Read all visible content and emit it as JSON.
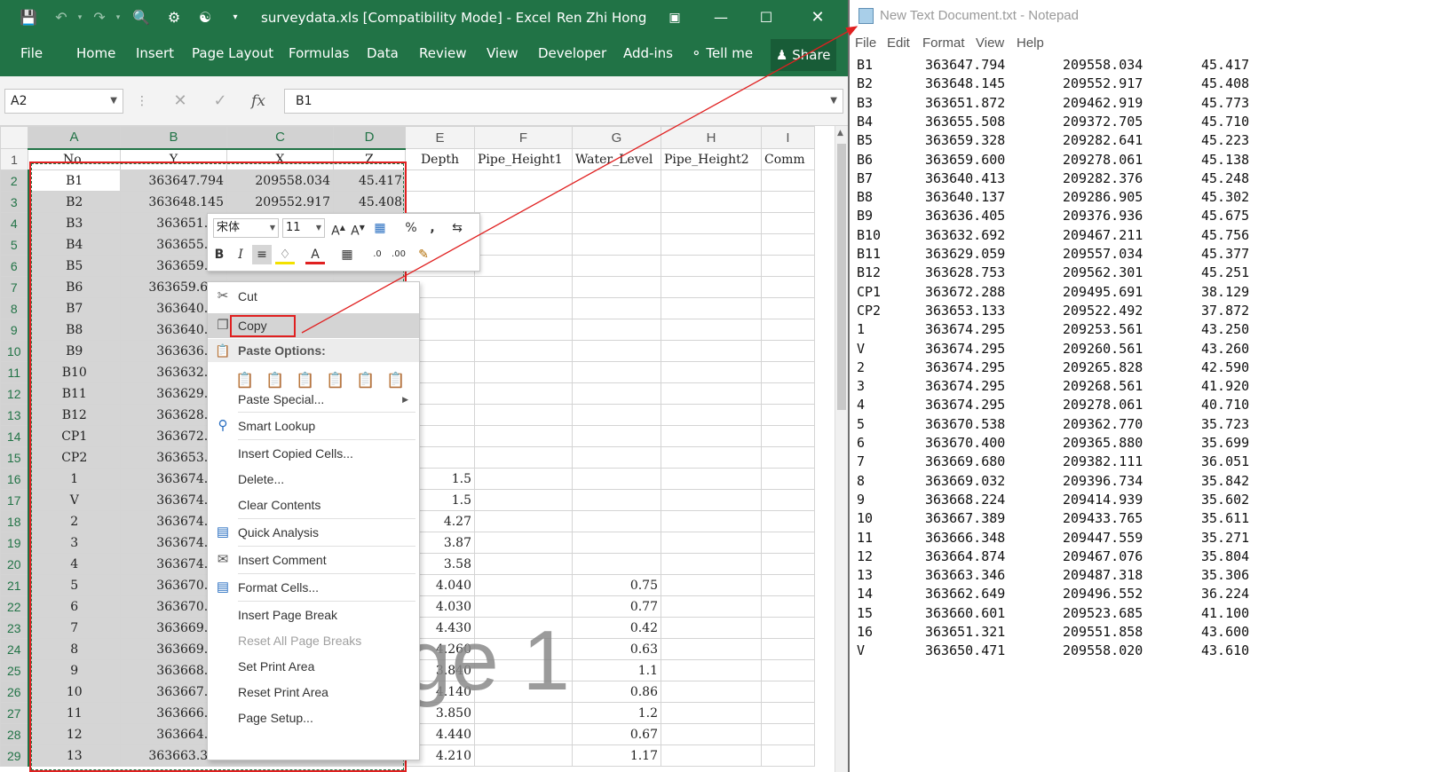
{
  "excel": {
    "title": "surveydata.xls  [Compatibility Mode]  -  Excel",
    "user": "Ren Zhi Hong",
    "ribbon_tabs": [
      "File",
      "Home",
      "Insert",
      "Page Layout",
      "Formulas",
      "Data",
      "Review",
      "View",
      "Developer",
      "Add-ins"
    ],
    "tell_me": "Tell me",
    "share": "Share",
    "name_box": "A2",
    "formula": "B1",
    "columns": [
      "A",
      "B",
      "C",
      "D",
      "E",
      "F",
      "G",
      "H",
      "I"
    ],
    "header_row": [
      "No.",
      "Y",
      "X",
      "Z",
      "Depth",
      "Pipe_Height1",
      "Water_Level",
      "Pipe_Height2",
      "Comm"
    ],
    "rows": [
      {
        "n": "2",
        "a": "B1",
        "b": "363647.794",
        "c": "209558.034",
        "d": "45.417",
        "e": "",
        "g": ""
      },
      {
        "n": "3",
        "a": "B2",
        "b": "363648.145",
        "c": "209552.917",
        "d": "45.408",
        "e": "",
        "g": ""
      },
      {
        "n": "4",
        "a": "B3",
        "b": "363651.87",
        "c": "",
        "d": "",
        "e": "",
        "g": ""
      },
      {
        "n": "5",
        "a": "B4",
        "b": "363655.50",
        "c": "",
        "d": "",
        "e": "",
        "g": ""
      },
      {
        "n": "6",
        "a": "B5",
        "b": "363659.32",
        "c": "",
        "d": "",
        "e": "",
        "g": ""
      },
      {
        "n": "7",
        "a": "B6",
        "b": "363659.600",
        "c": "209278.061",
        "d": "45.138",
        "e": "",
        "g": ""
      },
      {
        "n": "8",
        "a": "B7",
        "b": "363640.41",
        "c": "",
        "d": "",
        "e": "",
        "g": ""
      },
      {
        "n": "9",
        "a": "B8",
        "b": "363640.13",
        "c": "",
        "d": "",
        "e": "",
        "g": ""
      },
      {
        "n": "10",
        "a": "B9",
        "b": "363636.40",
        "c": "",
        "d": "",
        "e": "",
        "g": ""
      },
      {
        "n": "11",
        "a": "B10",
        "b": "363632.69",
        "c": "",
        "d": "",
        "e": "",
        "g": ""
      },
      {
        "n": "12",
        "a": "B11",
        "b": "363629.05",
        "c": "",
        "d": "",
        "e": "",
        "g": ""
      },
      {
        "n": "13",
        "a": "B12",
        "b": "363628.75",
        "c": "",
        "d": "",
        "e": "",
        "g": ""
      },
      {
        "n": "14",
        "a": "CP1",
        "b": "363672.28",
        "c": "",
        "d": "",
        "e": "",
        "g": ""
      },
      {
        "n": "15",
        "a": "CP2",
        "b": "363653.13",
        "c": "",
        "d": "",
        "e": "",
        "g": ""
      },
      {
        "n": "16",
        "a": "1",
        "b": "363674.29",
        "c": "",
        "d": "",
        "e": "1.5",
        "g": ""
      },
      {
        "n": "17",
        "a": "V",
        "b": "363674.29",
        "c": "",
        "d": "",
        "e": "1.5",
        "g": ""
      },
      {
        "n": "18",
        "a": "2",
        "b": "363674.29",
        "c": "",
        "d": "",
        "e": "4.27",
        "g": ""
      },
      {
        "n": "19",
        "a": "3",
        "b": "363674.29",
        "c": "",
        "d": "",
        "e": "3.87",
        "g": ""
      },
      {
        "n": "20",
        "a": "4",
        "b": "363674.29",
        "c": "",
        "d": "",
        "e": "3.58",
        "g": ""
      },
      {
        "n": "21",
        "a": "5",
        "b": "363670.53",
        "c": "",
        "d": "",
        "e": "4.040",
        "g": "0.75"
      },
      {
        "n": "22",
        "a": "6",
        "b": "363670.40",
        "c": "",
        "d": "",
        "e": "4.030",
        "g": "0.77"
      },
      {
        "n": "23",
        "a": "7",
        "b": "363669.68",
        "c": "",
        "d": "",
        "e": "4.430",
        "g": "0.42"
      },
      {
        "n": "24",
        "a": "8",
        "b": "363669.03",
        "c": "",
        "d": "",
        "e": "4.260",
        "g": "0.63"
      },
      {
        "n": "25",
        "a": "9",
        "b": "363668.22",
        "c": "",
        "d": "",
        "e": "3.840",
        "g": "1.1"
      },
      {
        "n": "26",
        "a": "10",
        "b": "363667.38",
        "c": "",
        "d": "",
        "e": "4.140",
        "g": "0.86"
      },
      {
        "n": "27",
        "a": "11",
        "b": "363666.34",
        "c": "",
        "d": "",
        "e": "3.850",
        "g": "1.2"
      },
      {
        "n": "28",
        "a": "12",
        "b": "363664.87",
        "c": "",
        "d": "",
        "e": "4.440",
        "g": "0.67"
      },
      {
        "n": "29",
        "a": "13",
        "b": "363663.346",
        "c": "209487.318",
        "d": "35.306",
        "e": "4.210",
        "g": "1.17"
      }
    ],
    "watermark": "ge 1",
    "mini_toolbar": {
      "font": "宋体",
      "size": "11"
    },
    "context_menu": {
      "cut": "Cut",
      "copy": "Copy",
      "paste_options": "Paste Options:",
      "paste_special": "Paste Special...",
      "smart_lookup": "Smart Lookup",
      "insert_copied": "Insert Copied Cells...",
      "delete": "Delete...",
      "clear_contents": "Clear Contents",
      "quick_analysis": "Quick Analysis",
      "insert_comment": "Insert Comment",
      "format_cells": "Format Cells...",
      "insert_page_break": "Insert Page Break",
      "reset_all_page_breaks": "Reset All Page Breaks",
      "set_print_area": "Set Print Area",
      "reset_print_area": "Reset Print Area",
      "page_setup": "Page Setup..."
    }
  },
  "notepad": {
    "title": "New Text Document.txt - Notepad",
    "menu": [
      "File",
      "Edit",
      "Format",
      "View",
      "Help"
    ],
    "lines": [
      [
        "B1",
        "363647.794",
        "209558.034",
        "45.417"
      ],
      [
        "B2",
        "363648.145",
        "209552.917",
        "45.408"
      ],
      [
        "B3",
        "363651.872",
        "209462.919",
        "45.773"
      ],
      [
        "B4",
        "363655.508",
        "209372.705",
        "45.710"
      ],
      [
        "B5",
        "363659.328",
        "209282.641",
        "45.223"
      ],
      [
        "B6",
        "363659.600",
        "209278.061",
        "45.138"
      ],
      [
        "B7",
        "363640.413",
        "209282.376",
        "45.248"
      ],
      [
        "B8",
        "363640.137",
        "209286.905",
        "45.302"
      ],
      [
        "B9",
        "363636.405",
        "209376.936",
        "45.675"
      ],
      [
        "B10",
        "363632.692",
        "209467.211",
        "45.756"
      ],
      [
        "B11",
        "363629.059",
        "209557.034",
        "45.377"
      ],
      [
        "B12",
        "363628.753",
        "209562.301",
        "45.251"
      ],
      [
        "CP1",
        "363672.288",
        "209495.691",
        "38.129"
      ],
      [
        "CP2",
        "363653.133",
        "209522.492",
        "37.872"
      ],
      [
        "1",
        "363674.295",
        "209253.561",
        "43.250"
      ],
      [
        "V",
        "363674.295",
        "209260.561",
        "43.260"
      ],
      [
        "2",
        "363674.295",
        "209265.828",
        "42.590"
      ],
      [
        "3",
        "363674.295",
        "209268.561",
        "41.920"
      ],
      [
        "4",
        "363674.295",
        "209278.061",
        "40.710"
      ],
      [
        "5",
        "363670.538",
        "209362.770",
        "35.723"
      ],
      [
        "6",
        "363670.400",
        "209365.880",
        "35.699"
      ],
      [
        "7",
        "363669.680",
        "209382.111",
        "36.051"
      ],
      [
        "8",
        "363669.032",
        "209396.734",
        "35.842"
      ],
      [
        "9",
        "363668.224",
        "209414.939",
        "35.602"
      ],
      [
        "10",
        "363667.389",
        "209433.765",
        "35.611"
      ],
      [
        "11",
        "363666.348",
        "209447.559",
        "35.271"
      ],
      [
        "12",
        "363664.874",
        "209467.076",
        "35.804"
      ],
      [
        "13",
        "363663.346",
        "209487.318",
        "35.306"
      ],
      [
        "14",
        "363662.649",
        "209496.552",
        "36.224"
      ],
      [
        "15",
        "363660.601",
        "209523.685",
        "41.100"
      ],
      [
        "16",
        "363651.321",
        "209551.858",
        "43.600"
      ],
      [
        "V",
        "363650.471",
        "209558.020",
        "43.610"
      ]
    ]
  },
  "colors": {
    "excel_green": "#217346",
    "highlight_red": "#e02020"
  }
}
